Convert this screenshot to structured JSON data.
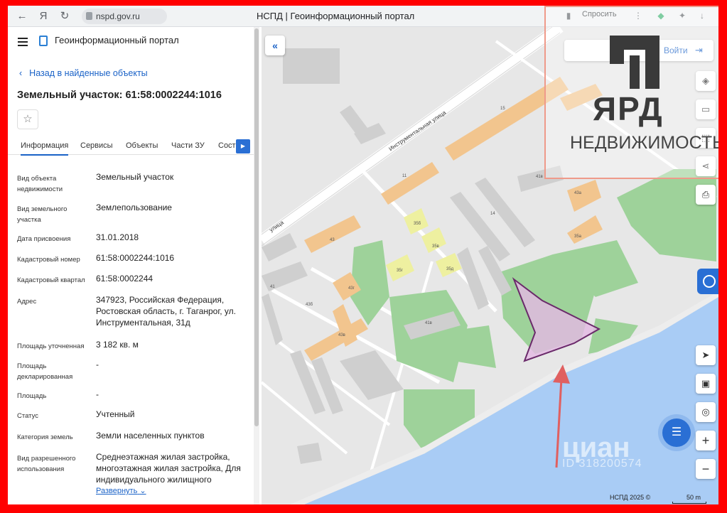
{
  "browser": {
    "url": "nspd.gov.ru",
    "title": "НСПД | Геоинформационный портал",
    "ask_button": "Спросить"
  },
  "sidebar": {
    "portal_title": "Геоинформационный портал",
    "back_link": "Назад в найденные объекты",
    "parcel_title": "Земельный участок: 61:58:0002244:1016",
    "tabs": [
      "Информация",
      "Сервисы",
      "Объекты",
      "Части ЗУ",
      "Соста"
    ],
    "fields": [
      {
        "label": "Вид объекта недвижимости",
        "value": "Земельный участок"
      },
      {
        "label": "Вид земельного участка",
        "value": "Землепользование"
      },
      {
        "label": "Дата присвоения",
        "value": "31.01.2018"
      },
      {
        "label": "Кадастровый номер",
        "value": "61:58:0002244:1016"
      },
      {
        "label": "Кадастровый квартал",
        "value": "61:58:0002244"
      },
      {
        "label": "Адрес",
        "value": "347923, Российская Федерация, Ростовская область, г. Таганрог, ул. Инструментальная, 31д"
      },
      {
        "label": "Площадь уточненная",
        "value": "3 182 кв. м"
      },
      {
        "label": "Площадь декларированная",
        "value": "-"
      },
      {
        "label": "Площадь",
        "value": "-"
      },
      {
        "label": "Статус",
        "value": "Учтенный"
      },
      {
        "label": "Категория земель",
        "value": "Земли населенных пунктов"
      },
      {
        "label": "Вид разрешенного использования",
        "value": "Среднеэтажная жилая застройка, многоэтажная жилая застройка, Для индивидуального жилищного"
      }
    ],
    "expand_link": "Развернуть"
  },
  "map": {
    "login_label": "Войти",
    "street_1": "Инструментальная улица",
    "street_2": "улица",
    "copyright": "НСПД 2025 ©",
    "scale": "50 m",
    "building_numbers": [
      "15",
      "11",
      "41",
      "43",
      "43б",
      "43в",
      "43г",
      "35б",
      "35в",
      "35г",
      "35д",
      "14",
      "41в",
      "43а",
      "35а",
      "41в"
    ],
    "colors": {
      "water": "#a9ccf5",
      "green": "#9ed29a",
      "building_orange": "#f2c58e",
      "building_yellow": "#eef0a0",
      "building_grey": "#cfcfcf",
      "parcel_fill": "#e3b9e3",
      "parcel_stroke": "#6a2a6a",
      "arrow": "#e06060"
    }
  },
  "watermark": {
    "brand": "ЯРД",
    "subtitle": "НЕДВИЖИМОСТЬ",
    "cian_text": "циан",
    "cian_id": "ID 318200574"
  }
}
